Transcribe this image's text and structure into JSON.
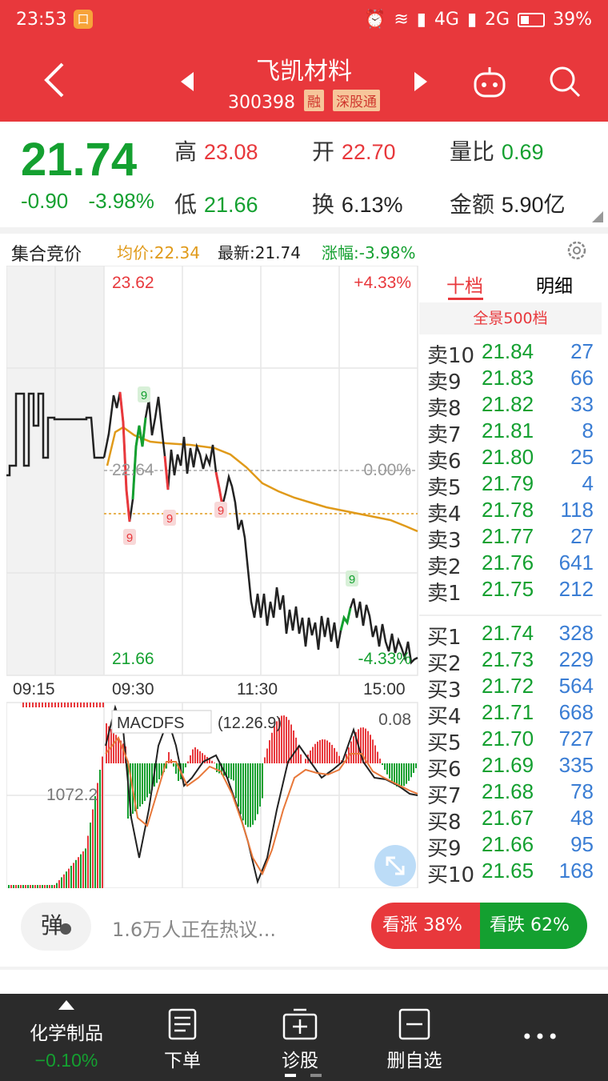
{
  "status": {
    "time": "23:53",
    "net1": "4G",
    "net2": "2G",
    "battery": "39%"
  },
  "header": {
    "title": "飞凯材料",
    "code": "300398",
    "tag1": "融",
    "tag2": "深股通"
  },
  "quote": {
    "price": "21.74",
    "change": "-0.90",
    "change_pct": "-3.98%",
    "high_label": "高",
    "high": "23.08",
    "open_label": "开",
    "open": "22.70",
    "vol_ratio_label": "量比",
    "vol_ratio": "0.69",
    "low_label": "低",
    "low": "21.66",
    "turnover_label": "换",
    "turnover": "6.13%",
    "amount_label": "金额",
    "amount": "5.90亿"
  },
  "infobar": {
    "auction": "集合竞价",
    "avg": "均价:22.34",
    "latest": "最新:21.74",
    "pct": "涨幅:-3.98%"
  },
  "chart": {
    "top_price": "23.62",
    "top_pct": "+4.33%",
    "mid_price": "22.64",
    "mid_pct": "0.00%",
    "bottom_price": "21.66",
    "bottom_pct": "-4.33%",
    "times": [
      "09:15",
      "09:30",
      "11:30",
      "15:00"
    ],
    "marker": "9",
    "macd_label": "MACDFS",
    "macd_params": "(12.26.9)",
    "macd_top": "0.08",
    "vol_label": "1072.2"
  },
  "book": {
    "tab1": "十档",
    "tab2": "明细",
    "full": "全景500档",
    "asks": [
      {
        "l": "卖10",
        "p": "21.84",
        "v": "27"
      },
      {
        "l": "卖9",
        "p": "21.83",
        "v": "66"
      },
      {
        "l": "卖8",
        "p": "21.82",
        "v": "33"
      },
      {
        "l": "卖7",
        "p": "21.81",
        "v": "8"
      },
      {
        "l": "卖6",
        "p": "21.80",
        "v": "25"
      },
      {
        "l": "卖5",
        "p": "21.79",
        "v": "4"
      },
      {
        "l": "卖4",
        "p": "21.78",
        "v": "118"
      },
      {
        "l": "卖3",
        "p": "21.77",
        "v": "27"
      },
      {
        "l": "卖2",
        "p": "21.76",
        "v": "641"
      },
      {
        "l": "卖1",
        "p": "21.75",
        "v": "212"
      }
    ],
    "bids": [
      {
        "l": "买1",
        "p": "21.74",
        "v": "328"
      },
      {
        "l": "买2",
        "p": "21.73",
        "v": "229"
      },
      {
        "l": "买3",
        "p": "21.72",
        "v": "564"
      },
      {
        "l": "买4",
        "p": "21.71",
        "v": "668"
      },
      {
        "l": "买5",
        "p": "21.70",
        "v": "727"
      },
      {
        "l": "买6",
        "p": "21.69",
        "v": "335"
      },
      {
        "l": "买7",
        "p": "21.68",
        "v": "78"
      },
      {
        "l": "买8",
        "p": "21.67",
        "v": "48"
      },
      {
        "l": "买9",
        "p": "21.66",
        "v": "95"
      },
      {
        "l": "买10",
        "p": "21.65",
        "v": "168"
      }
    ]
  },
  "social": {
    "danmu": "弹",
    "hot": "1.6万人正在热议...",
    "up": "看涨 38%",
    "down": "看跌 62%"
  },
  "bottom": {
    "sector": "化学制品",
    "sector_pct": "−0.10%",
    "order": "下单",
    "diagnose": "诊股",
    "remove": "删自选",
    "more": "•••"
  },
  "colors": {
    "red": "#e8383c",
    "green": "#14a030",
    "avg_line": "#e09a1a"
  }
}
